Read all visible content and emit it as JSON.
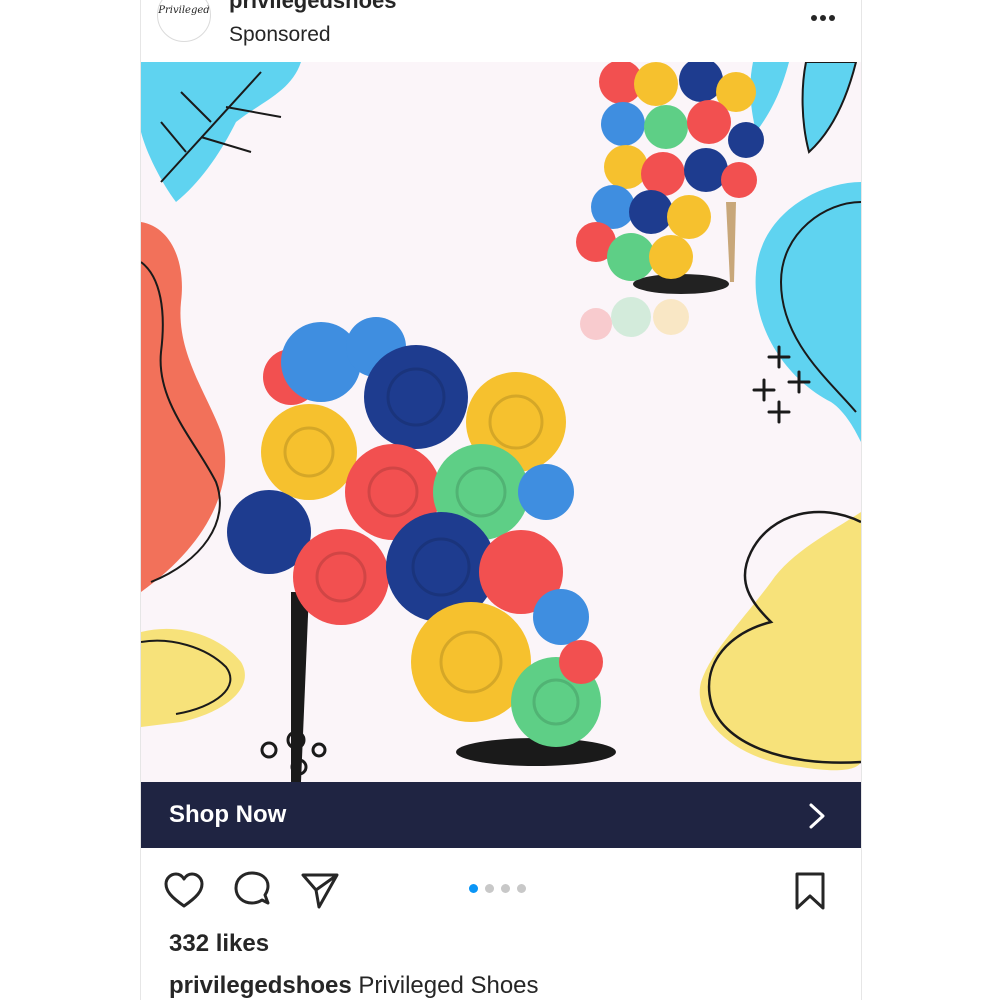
{
  "post": {
    "avatar_text": "Privileged",
    "username": "privilegedshoes",
    "sponsored_label": "Sponsored",
    "more_icon": "more-horizontal-icon"
  },
  "media": {
    "description_icon": "product-image",
    "carousel": {
      "total": 4,
      "active_index": 0
    }
  },
  "cta": {
    "label": "Shop Now",
    "icon": "chevron-right-icon"
  },
  "actions": {
    "like_icon": "heart-icon",
    "comment_icon": "comment-icon",
    "share_icon": "send-icon",
    "save_icon": "bookmark-icon"
  },
  "likes_text": "332 likes",
  "caption": {
    "username": "privilegedshoes",
    "text": "Privileged Shoes"
  },
  "colors": {
    "cta_background": "#1f2442",
    "active_dot": "#0a95f6",
    "inactive_dot": "#c8c8c8",
    "text": "#262626"
  }
}
